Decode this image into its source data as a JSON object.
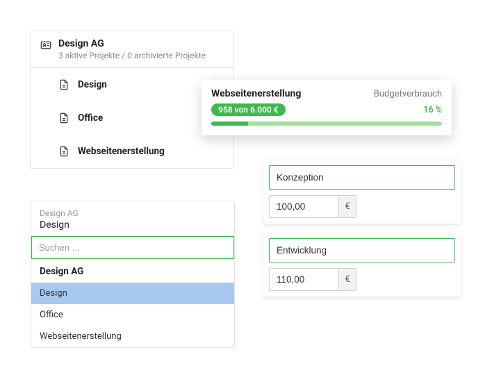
{
  "client_card": {
    "title": "Design AG",
    "subtitle": "3 aktive Projekte / 0 archivierte Projekte",
    "projects": [
      {
        "label": "Design"
      },
      {
        "label": "Office"
      },
      {
        "label": "Webseitenerstellung"
      }
    ]
  },
  "budget": {
    "title": "Webseitenerstellung",
    "right_label": "Budgetverbrauch",
    "pill": "958 von 6.000 €",
    "percent": "16 %",
    "percent_value": 16
  },
  "dropdown": {
    "company": "Design AG",
    "selected_project": "Design",
    "search_placeholder": "Suchen ...",
    "group_title": "Design AG",
    "items": [
      {
        "label": "Design",
        "selected": true
      },
      {
        "label": "Office",
        "selected": false
      },
      {
        "label": "Webseitenerstellung",
        "selected": false
      }
    ]
  },
  "rates": [
    {
      "name": "Konzeption",
      "value": "100,00",
      "unit": "€"
    },
    {
      "name": "Entwicklung",
      "value": "110,00",
      "unit": "€"
    }
  ]
}
